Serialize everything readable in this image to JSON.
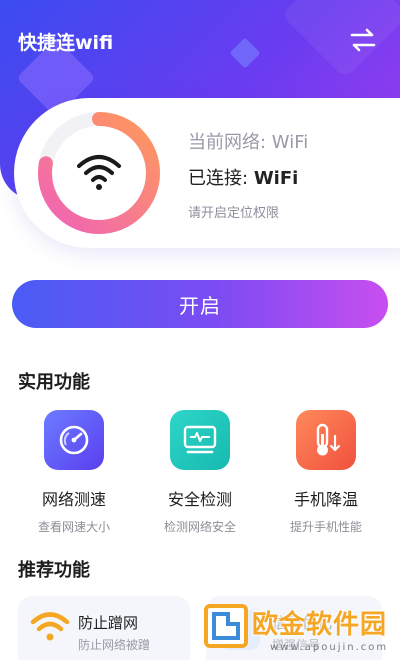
{
  "app": {
    "title": "快捷连wifi"
  },
  "status": {
    "network_label": "当前网络: WiFi",
    "connected_prefix": "已连接:",
    "connected_name": "WiFi",
    "location_hint": "请开启定位权限"
  },
  "start_button": {
    "label": "开启"
  },
  "practical": {
    "title": "实用功能",
    "items": [
      {
        "name": "网络测速",
        "desc": "查看网速大小",
        "icon": "speedometer-icon"
      },
      {
        "name": "安全检测",
        "desc": "检测网络安全",
        "icon": "monitor-pulse-icon"
      },
      {
        "name": "手机降温",
        "desc": "提升手机性能",
        "icon": "thermometer-icon"
      }
    ]
  },
  "recommended": {
    "title": "推荐功能",
    "items": [
      {
        "name": "防止蹭网",
        "desc": "防止网络被蹭",
        "icon": "wifi-icon"
      },
      {
        "name": "信号优化",
        "desc": "增强信号",
        "icon": "signal-icon"
      }
    ]
  },
  "watermark": {
    "text": "欧金软件园",
    "url": "www.apoujin.com"
  },
  "colors": {
    "primary": "#5a4cf2",
    "ring_pink": "#f062b8",
    "ring_orange": "#ff9a5a",
    "speed": "#5a3ef0",
    "safe": "#16b9b0",
    "temp": "#f0503c"
  }
}
